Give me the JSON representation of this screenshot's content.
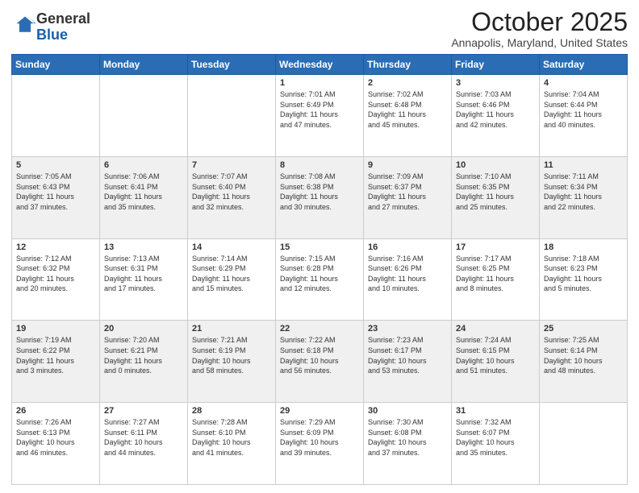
{
  "logo": {
    "general": "General",
    "blue": "Blue"
  },
  "header": {
    "month": "October 2025",
    "location": "Annapolis, Maryland, United States"
  },
  "days": [
    "Sunday",
    "Monday",
    "Tuesday",
    "Wednesday",
    "Thursday",
    "Friday",
    "Saturday"
  ],
  "weeks": [
    [
      {
        "day": "",
        "info": ""
      },
      {
        "day": "",
        "info": ""
      },
      {
        "day": "",
        "info": ""
      },
      {
        "day": "1",
        "info": "Sunrise: 7:01 AM\nSunset: 6:49 PM\nDaylight: 11 hours\nand 47 minutes."
      },
      {
        "day": "2",
        "info": "Sunrise: 7:02 AM\nSunset: 6:48 PM\nDaylight: 11 hours\nand 45 minutes."
      },
      {
        "day": "3",
        "info": "Sunrise: 7:03 AM\nSunset: 6:46 PM\nDaylight: 11 hours\nand 42 minutes."
      },
      {
        "day": "4",
        "info": "Sunrise: 7:04 AM\nSunset: 6:44 PM\nDaylight: 11 hours\nand 40 minutes."
      }
    ],
    [
      {
        "day": "5",
        "info": "Sunrise: 7:05 AM\nSunset: 6:43 PM\nDaylight: 11 hours\nand 37 minutes."
      },
      {
        "day": "6",
        "info": "Sunrise: 7:06 AM\nSunset: 6:41 PM\nDaylight: 11 hours\nand 35 minutes."
      },
      {
        "day": "7",
        "info": "Sunrise: 7:07 AM\nSunset: 6:40 PM\nDaylight: 11 hours\nand 32 minutes."
      },
      {
        "day": "8",
        "info": "Sunrise: 7:08 AM\nSunset: 6:38 PM\nDaylight: 11 hours\nand 30 minutes."
      },
      {
        "day": "9",
        "info": "Sunrise: 7:09 AM\nSunset: 6:37 PM\nDaylight: 11 hours\nand 27 minutes."
      },
      {
        "day": "10",
        "info": "Sunrise: 7:10 AM\nSunset: 6:35 PM\nDaylight: 11 hours\nand 25 minutes."
      },
      {
        "day": "11",
        "info": "Sunrise: 7:11 AM\nSunset: 6:34 PM\nDaylight: 11 hours\nand 22 minutes."
      }
    ],
    [
      {
        "day": "12",
        "info": "Sunrise: 7:12 AM\nSunset: 6:32 PM\nDaylight: 11 hours\nand 20 minutes."
      },
      {
        "day": "13",
        "info": "Sunrise: 7:13 AM\nSunset: 6:31 PM\nDaylight: 11 hours\nand 17 minutes."
      },
      {
        "day": "14",
        "info": "Sunrise: 7:14 AM\nSunset: 6:29 PM\nDaylight: 11 hours\nand 15 minutes."
      },
      {
        "day": "15",
        "info": "Sunrise: 7:15 AM\nSunset: 6:28 PM\nDaylight: 11 hours\nand 12 minutes."
      },
      {
        "day": "16",
        "info": "Sunrise: 7:16 AM\nSunset: 6:26 PM\nDaylight: 11 hours\nand 10 minutes."
      },
      {
        "day": "17",
        "info": "Sunrise: 7:17 AM\nSunset: 6:25 PM\nDaylight: 11 hours\nand 8 minutes."
      },
      {
        "day": "18",
        "info": "Sunrise: 7:18 AM\nSunset: 6:23 PM\nDaylight: 11 hours\nand 5 minutes."
      }
    ],
    [
      {
        "day": "19",
        "info": "Sunrise: 7:19 AM\nSunset: 6:22 PM\nDaylight: 11 hours\nand 3 minutes."
      },
      {
        "day": "20",
        "info": "Sunrise: 7:20 AM\nSunset: 6:21 PM\nDaylight: 11 hours\nand 0 minutes."
      },
      {
        "day": "21",
        "info": "Sunrise: 7:21 AM\nSunset: 6:19 PM\nDaylight: 10 hours\nand 58 minutes."
      },
      {
        "day": "22",
        "info": "Sunrise: 7:22 AM\nSunset: 6:18 PM\nDaylight: 10 hours\nand 56 minutes."
      },
      {
        "day": "23",
        "info": "Sunrise: 7:23 AM\nSunset: 6:17 PM\nDaylight: 10 hours\nand 53 minutes."
      },
      {
        "day": "24",
        "info": "Sunrise: 7:24 AM\nSunset: 6:15 PM\nDaylight: 10 hours\nand 51 minutes."
      },
      {
        "day": "25",
        "info": "Sunrise: 7:25 AM\nSunset: 6:14 PM\nDaylight: 10 hours\nand 48 minutes."
      }
    ],
    [
      {
        "day": "26",
        "info": "Sunrise: 7:26 AM\nSunset: 6:13 PM\nDaylight: 10 hours\nand 46 minutes."
      },
      {
        "day": "27",
        "info": "Sunrise: 7:27 AM\nSunset: 6:11 PM\nDaylight: 10 hours\nand 44 minutes."
      },
      {
        "day": "28",
        "info": "Sunrise: 7:28 AM\nSunset: 6:10 PM\nDaylight: 10 hours\nand 41 minutes."
      },
      {
        "day": "29",
        "info": "Sunrise: 7:29 AM\nSunset: 6:09 PM\nDaylight: 10 hours\nand 39 minutes."
      },
      {
        "day": "30",
        "info": "Sunrise: 7:30 AM\nSunset: 6:08 PM\nDaylight: 10 hours\nand 37 minutes."
      },
      {
        "day": "31",
        "info": "Sunrise: 7:32 AM\nSunset: 6:07 PM\nDaylight: 10 hours\nand 35 minutes."
      },
      {
        "day": "",
        "info": ""
      }
    ]
  ]
}
